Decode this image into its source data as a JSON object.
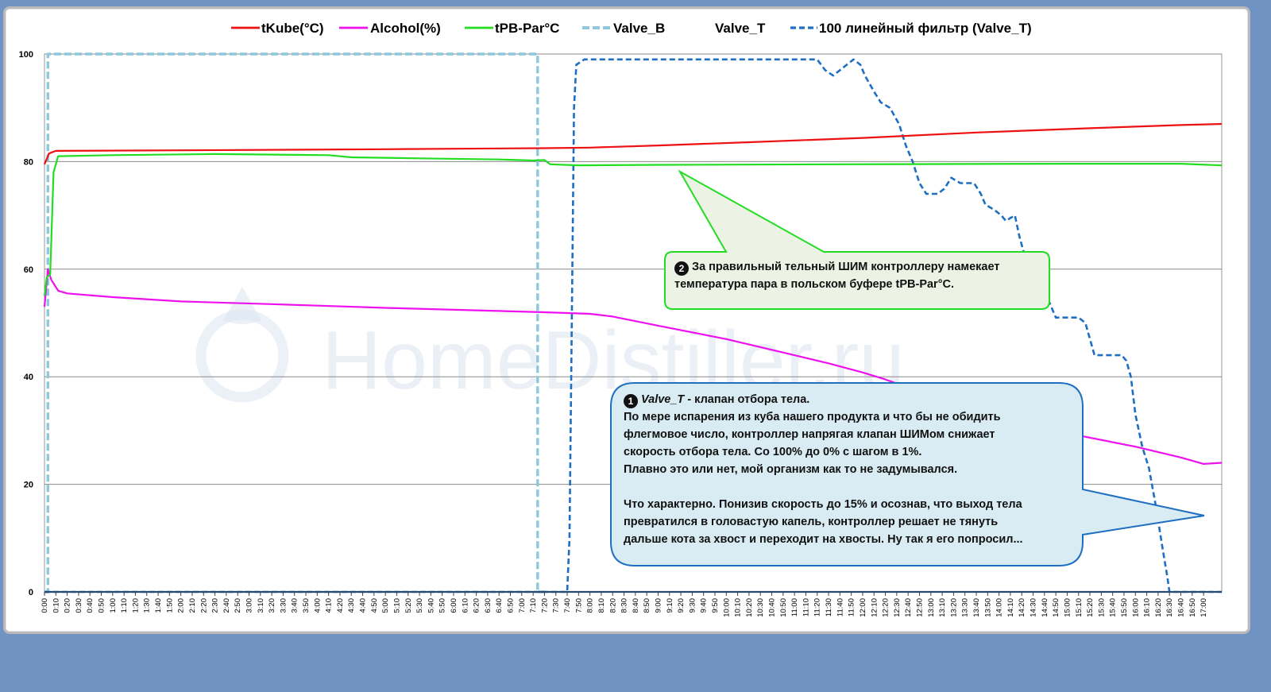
{
  "chart_data": {
    "type": "line",
    "watermark": "HomeDistiller.ru",
    "legend_position": "top",
    "ylim": [
      0,
      100
    ],
    "yticks": [
      0,
      20,
      40,
      60,
      80,
      100
    ],
    "grid": true,
    "xlabels": [
      "0:00",
      "0:10",
      "0:20",
      "0:30",
      "0:40",
      "0:50",
      "1:00",
      "1:10",
      "1:20",
      "1:30",
      "1:40",
      "1:50",
      "2:00",
      "2:10",
      "2:20",
      "2:30",
      "2:40",
      "2:50",
      "3:00",
      "3:10",
      "3:20",
      "3:30",
      "3:40",
      "3:50",
      "4:00",
      "4:10",
      "4:20",
      "4:30",
      "4:40",
      "4:50",
      "5:00",
      "5:10",
      "5:20",
      "5:30",
      "5:40",
      "5:50",
      "6:00",
      "6:10",
      "6:20",
      "6:30",
      "6:40",
      "6:50",
      "7:00",
      "7:10",
      "7:20",
      "7:30",
      "7:40",
      "7:50",
      "8:00",
      "8:10",
      "8:20",
      "8:30",
      "8:40",
      "8:50",
      "9:00",
      "9:10",
      "9:20",
      "9:30",
      "9:40",
      "9:50",
      "10:00",
      "10:10",
      "10:20",
      "10:30",
      "10:40",
      "10:50",
      "11:00",
      "11:10",
      "11:20",
      "11:30",
      "11:40",
      "11:50",
      "12:00",
      "12:10",
      "12:20",
      "12:30",
      "12:40",
      "12:50",
      "13:00",
      "13:10",
      "13:20",
      "13:30",
      "13:40",
      "13:50",
      "14:00",
      "14:10",
      "14:20",
      "14:30",
      "14:40",
      "14:50",
      "15:00",
      "15:10",
      "15:20",
      "15:30",
      "15:40",
      "15:50",
      "16:00",
      "16:10",
      "16:20",
      "16:30",
      "16:40",
      "16:50",
      "17:00"
    ],
    "x_minutes_max": 1036,
    "series": [
      {
        "name": "tKube(°C)",
        "color": "#ee1111",
        "style": "solid",
        "points": [
          [
            0,
            79.5
          ],
          [
            4,
            81.5
          ],
          [
            10,
            82
          ],
          [
            120,
            82.1
          ],
          [
            300,
            82.3
          ],
          [
            440,
            82.5
          ],
          [
            480,
            82.6
          ],
          [
            540,
            83
          ],
          [
            620,
            83.6
          ],
          [
            720,
            84.4
          ],
          [
            820,
            85.4
          ],
          [
            920,
            86.2
          ],
          [
            1000,
            86.8
          ],
          [
            1036,
            87
          ]
        ]
      },
      {
        "name": "Alcohol(%)",
        "color": "#ee11ee",
        "style": "solid",
        "points": [
          [
            0,
            53
          ],
          [
            3,
            60
          ],
          [
            6,
            58
          ],
          [
            12,
            56
          ],
          [
            20,
            55.5
          ],
          [
            60,
            54.8
          ],
          [
            120,
            54
          ],
          [
            200,
            53.5
          ],
          [
            300,
            52.8
          ],
          [
            440,
            52
          ],
          [
            480,
            51.7
          ],
          [
            500,
            51.2
          ],
          [
            540,
            49.5
          ],
          [
            600,
            47
          ],
          [
            660,
            44
          ],
          [
            690,
            42.5
          ],
          [
            720,
            40.8
          ],
          [
            740,
            39.5
          ],
          [
            800,
            35
          ],
          [
            860,
            31
          ],
          [
            900,
            29.5
          ],
          [
            960,
            27
          ],
          [
            1000,
            25
          ],
          [
            1020,
            23.8
          ],
          [
            1036,
            24
          ]
        ]
      },
      {
        "name": "tPB-Par°C",
        "color": "#22dd22",
        "style": "solid",
        "points": [
          [
            0,
            55
          ],
          [
            2,
            58.5
          ],
          [
            5,
            59
          ],
          [
            8,
            78
          ],
          [
            12,
            81
          ],
          [
            60,
            81.2
          ],
          [
            150,
            81.4
          ],
          [
            250,
            81.2
          ],
          [
            270,
            80.8
          ],
          [
            330,
            80.6
          ],
          [
            400,
            80.4
          ],
          [
            430,
            80.2
          ],
          [
            440,
            80.3
          ],
          [
            445,
            79.5
          ],
          [
            470,
            79.3
          ],
          [
            540,
            79.4
          ],
          [
            700,
            79.5
          ],
          [
            900,
            79.6
          ],
          [
            1000,
            79.6
          ],
          [
            1036,
            79.3
          ]
        ]
      },
      {
        "name": "Valve_B",
        "color": "#8ec8dc",
        "style": "dash-thick",
        "points": [
          [
            0,
            0
          ],
          [
            3,
            0
          ],
          [
            3,
            100
          ],
          [
            434,
            100
          ],
          [
            434,
            0
          ],
          [
            440,
            0
          ]
        ]
      },
      {
        "name": "Valve_T",
        "color": "#1f5fa8",
        "style": "solid",
        "points": [
          [
            0,
            0
          ],
          [
            1036,
            0
          ]
        ]
      },
      {
        "name": "100 линейный фильтр (Valve_T)",
        "color": "#1e6fc2",
        "style": "dash",
        "points": [
          [
            0,
            0
          ],
          [
            460,
            0
          ],
          [
            462,
            10
          ],
          [
            464,
            50
          ],
          [
            466,
            90
          ],
          [
            468,
            98
          ],
          [
            475,
            99
          ],
          [
            680,
            99
          ],
          [
            687,
            97
          ],
          [
            694,
            96
          ],
          [
            700,
            97
          ],
          [
            706,
            98
          ],
          [
            712,
            99
          ],
          [
            718,
            98
          ],
          [
            722,
            96
          ],
          [
            730,
            93
          ],
          [
            736,
            91
          ],
          [
            744,
            90
          ],
          [
            752,
            87
          ],
          [
            758,
            83
          ],
          [
            764,
            80
          ],
          [
            770,
            76
          ],
          [
            776,
            74
          ],
          [
            786,
            74
          ],
          [
            792,
            75
          ],
          [
            798,
            77
          ],
          [
            806,
            76
          ],
          [
            818,
            76
          ],
          [
            824,
            74
          ],
          [
            828,
            72
          ],
          [
            836,
            71
          ],
          [
            842,
            70
          ],
          [
            846,
            69
          ],
          [
            854,
            70
          ],
          [
            858,
            66
          ],
          [
            862,
            63
          ],
          [
            870,
            63
          ],
          [
            876,
            60
          ],
          [
            880,
            56
          ],
          [
            886,
            53
          ],
          [
            890,
            51
          ],
          [
            904,
            51
          ],
          [
            910,
            51
          ],
          [
            916,
            50
          ],
          [
            920,
            47
          ],
          [
            924,
            44
          ],
          [
            934,
            44
          ],
          [
            944,
            44
          ],
          [
            948,
            44
          ],
          [
            952,
            43
          ],
          [
            956,
            40
          ],
          [
            960,
            33
          ],
          [
            966,
            27
          ],
          [
            972,
            23
          ],
          [
            978,
            16
          ],
          [
            984,
            8
          ],
          [
            988,
            3
          ],
          [
            990,
            0
          ],
          [
            1036,
            0
          ]
        ]
      }
    ]
  },
  "callouts": {
    "one": {
      "badge": "1",
      "line1_name": "Valve_T",
      "line1_rest": " - клапан  отбора тела.",
      "line2": "По мере испарения из куба нашего продукта  и что бы не обидить",
      "line3": "флегмовое число, контроллер  напрягая  клапан  ШИМом снижает",
      "line4": "скорость отбора  тела.  Со 100% до 0% с шагом в 1%.",
      "line5": "Плавно это или нет, мой организм  как то не задумывался.",
      "line6": "Что характерно.  Понизив скорость  до 15% и осознав, что выход тела",
      "line7": "превратился  в головастую  капель,  контроллер  решает не тянуть",
      "line8": "дальше кота за хвост и переходит на хвосты. Ну так я его попросил..."
    },
    "two": {
      "badge": "2",
      "line1": "За правильный  тельный ШИМ контроллеру  намекает",
      "line2": "температура пара в польском буфере tPB-Par°C."
    }
  }
}
